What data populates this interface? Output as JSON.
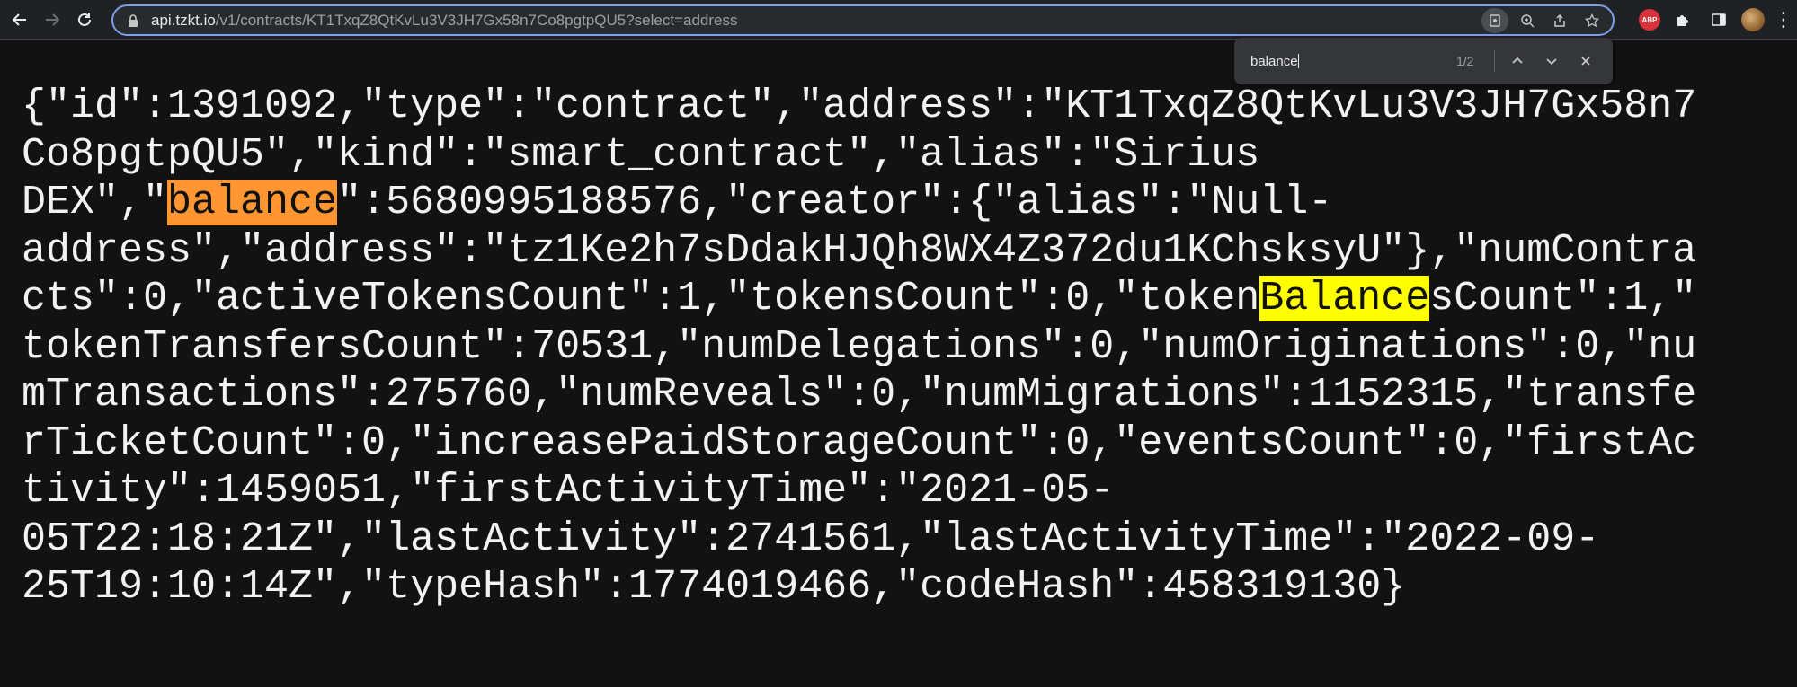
{
  "browser": {
    "url_host": "api.tzkt.io",
    "url_path": "/v1/contracts/KT1TxqZ8QtKvLu3V3JH7Gx58n7Co8pgtpQU5?select=address",
    "extension_label": "ABP"
  },
  "find_bar": {
    "query": "balance",
    "count": "1/2"
  },
  "json_lines": [
    {
      "pre": "{\"id\":1391092,\"type\":\"contract\",\"address\":\"KT1TxqZ8QtKvLu3V3JH7Gx58n7",
      "hl": "",
      "post": ""
    },
    {
      "pre": "Co8pgtpQU5\",\"kind\":\"smart_contract\",\"alias\":\"Sirius",
      "hl": "",
      "post": ""
    },
    {
      "pre": "DEX\",\"",
      "hl": "balance",
      "post": "\":5680995188576,\"creator\":{\"alias\":\"Null-"
    },
    {
      "pre": "address\",\"address\":\"tz1Ke2h7sDdakHJQh8WX4Z372du1KChsksyU\"},\"numContra",
      "hl": "",
      "post": ""
    },
    {
      "pre": "cts\":0,\"activeTokensCount\":1,\"tokensCount\":0,\"token",
      "hl": "Balance",
      "post": "sCount\":1,\""
    },
    {
      "pre": "tokenTransfersCount\":70531,\"numDelegations\":0,\"numOriginations\":0,\"nu",
      "hl": "",
      "post": ""
    },
    {
      "pre": "mTransactions\":275760,\"numReveals\":0,\"numMigrations\":1152315,\"transfe",
      "hl": "",
      "post": ""
    },
    {
      "pre": "rTicketCount\":0,\"increasePaidStorageCount\":0,\"eventsCount\":0,\"firstAc",
      "hl": "",
      "post": ""
    },
    {
      "pre": "tivity\":1459051,\"firstActivityTime\":\"2021-05-",
      "hl": "",
      "post": ""
    },
    {
      "pre": "05T22:18:21Z\",\"lastActivity\":2741561,\"lastActivityTime\":\"2022-09-",
      "hl": "",
      "post": ""
    },
    {
      "pre": "25T19:10:14Z\",\"typeHash\":1774019466,\"codeHash\":458319130}",
      "hl": "",
      "post": ""
    }
  ],
  "colors": {
    "current_match": "#ff9632",
    "other_match": "#ffff00",
    "page_background": "#121212"
  }
}
